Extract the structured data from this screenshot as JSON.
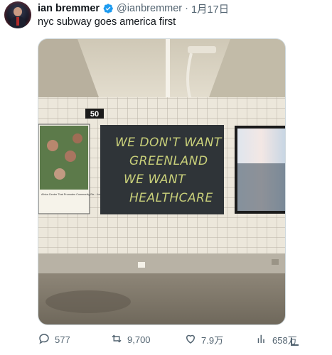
{
  "tweet": {
    "author_name": "ian bremmer",
    "handle": "@ianbremmer",
    "separator": "·",
    "date": "1月17日",
    "text": "nyc subway goes america first",
    "verified": true
  },
  "media": {
    "station_sign": "50",
    "chalkboard_lines": [
      "WE DON'T WANT",
      "GREENLAND",
      "WE WANT",
      "HEALTHCARE"
    ],
    "poster_text": "Africa Center That Promotes Community Re... for Family & Professional, Mental Trauma"
  },
  "actions": {
    "replies": "577",
    "reposts": "9,700",
    "likes": "7.9万",
    "views": "658万"
  },
  "colors": {
    "verified": "#1d9bf0",
    "muted": "#536471",
    "chalk": "#c9d07a"
  },
  "icons": [
    "verified-badge-icon",
    "reply-icon",
    "repost-icon",
    "like-icon",
    "views-icon",
    "share-icon"
  ]
}
